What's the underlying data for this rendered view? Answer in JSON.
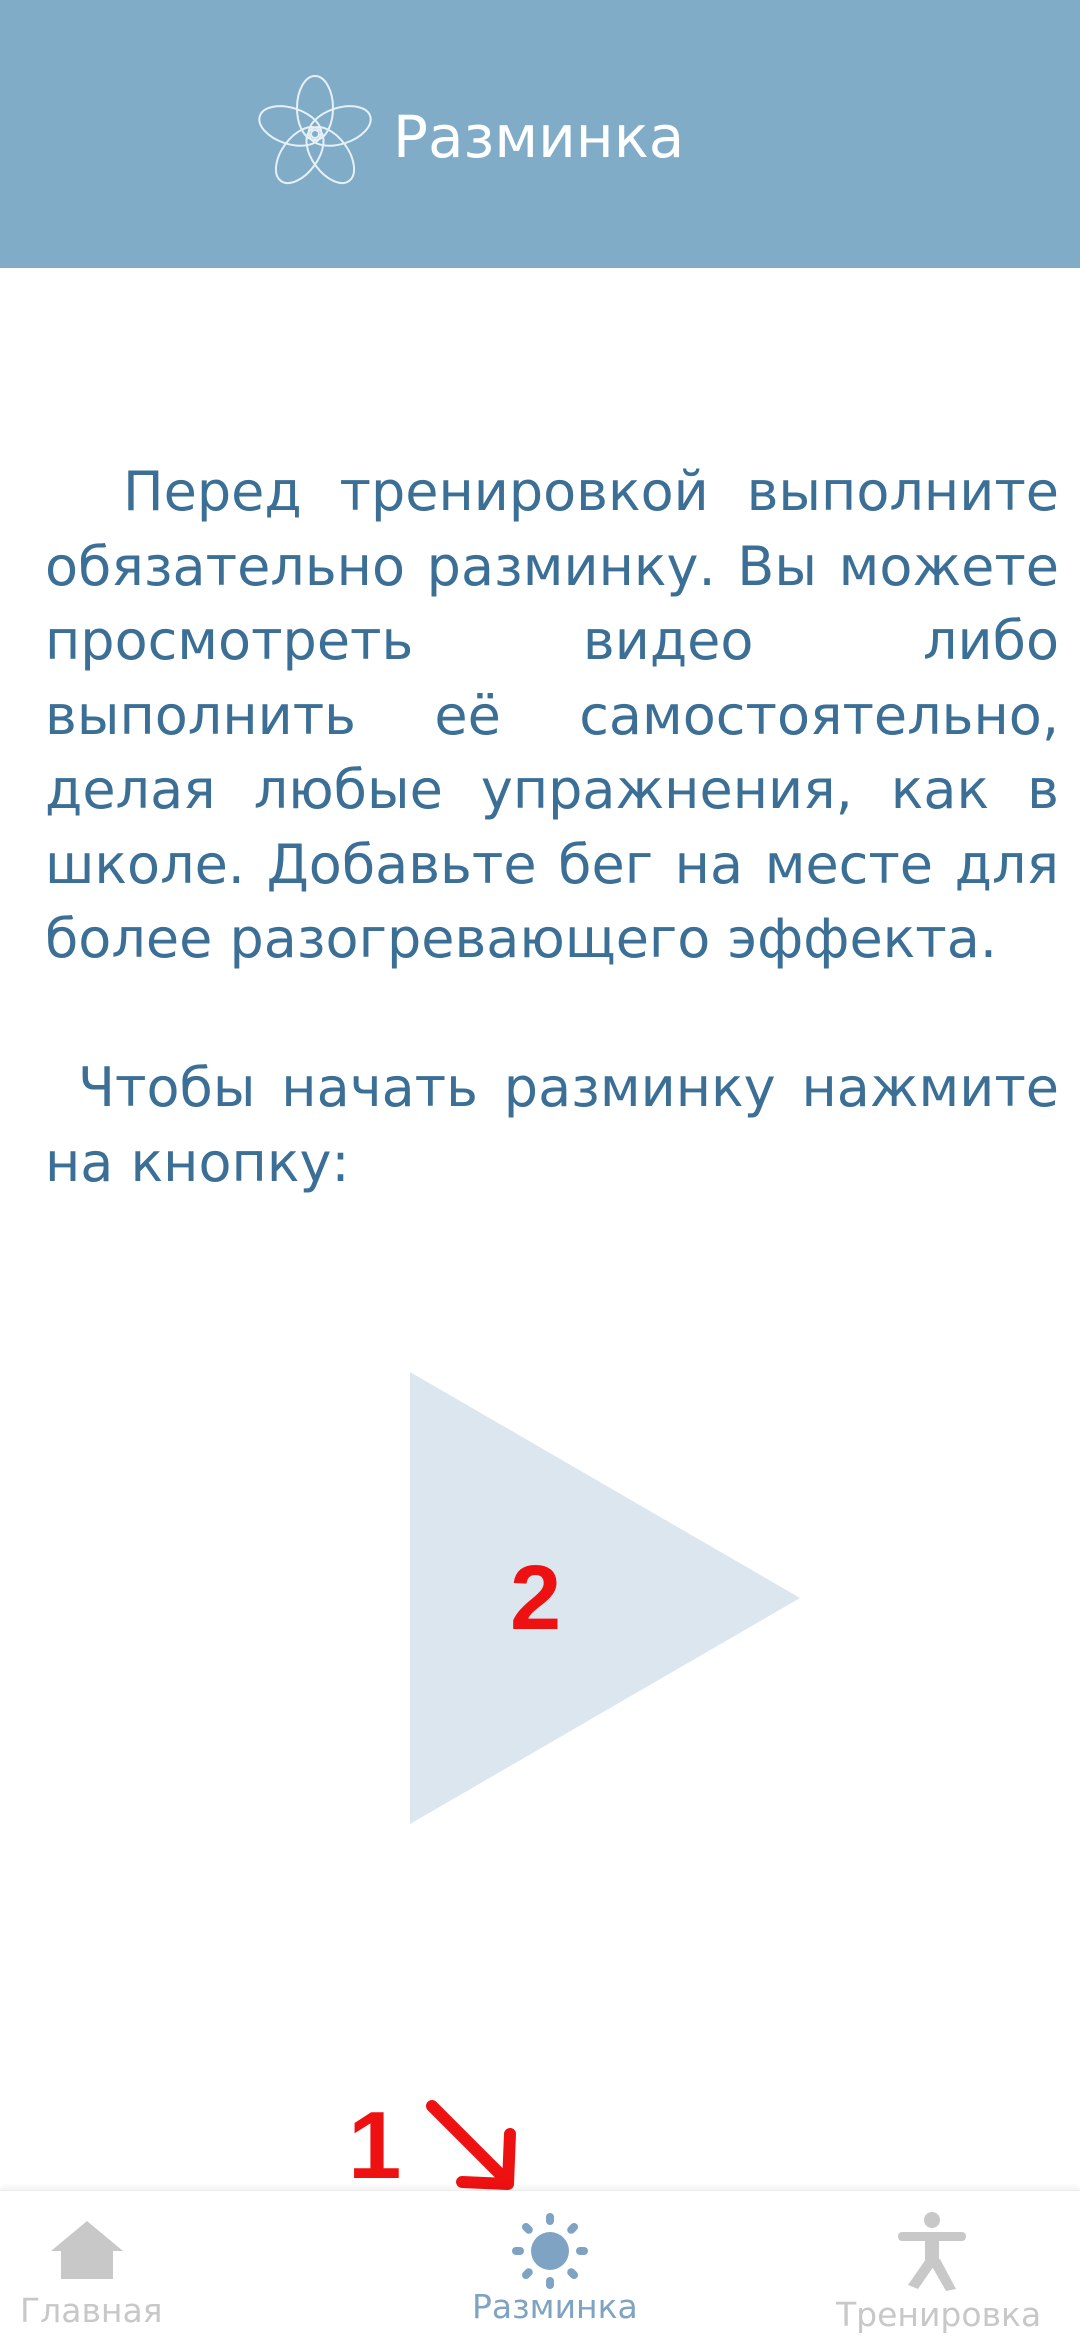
{
  "header": {
    "title": "Разминка",
    "logo_icon": "flower-logo-icon",
    "background_color": "#80acc8"
  },
  "content": {
    "paragraph_1": "Перед тренировкой выполните обязательно разминку. Вы можете просмотреть видео либо выполнить её самостоятельно, делая любые упражнения, как в школе. Добавьте бег на месте для более разогревающего эффекта.",
    "paragraph_2": "Чтобы начать разминку нажмите на кнопку:",
    "text_color": "#3b6f96"
  },
  "play_button": {
    "icon": "play-icon",
    "color": "#dbe6ef"
  },
  "annotations": {
    "marker_1": "1",
    "marker_2": "2",
    "color": "#ee1111"
  },
  "bottom_nav": {
    "items": [
      {
        "label": "Главная",
        "icon": "home-icon",
        "active": false
      },
      {
        "label": "Разминка",
        "icon": "sun-icon",
        "active": true
      },
      {
        "label": "Тренировка",
        "icon": "exercise-figure-icon",
        "active": false
      }
    ],
    "active_color": "#7fa3c2",
    "inactive_color": "#c8c8c8"
  }
}
